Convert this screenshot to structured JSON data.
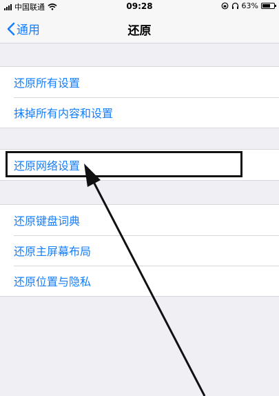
{
  "status_bar": {
    "carrier": "中国联通",
    "time": "09:28",
    "battery": "63%"
  },
  "nav": {
    "back_label": "通用",
    "title": "还原"
  },
  "groups": [
    {
      "items": [
        "还原所有设置",
        "抹掉所有内容和设置"
      ]
    },
    {
      "items": [
        "还原网络设置"
      ]
    },
    {
      "items": [
        "还原键盘词典",
        "还原主屏幕布局",
        "还原位置与隐私"
      ]
    }
  ],
  "icons": [
    "signal-icon",
    "wifi-icon",
    "lock-rotation-icon",
    "headphones-icon",
    "battery-icon",
    "chevron-left-icon"
  ],
  "colors": {
    "accent": "#157efb",
    "background": "#efeff4"
  }
}
